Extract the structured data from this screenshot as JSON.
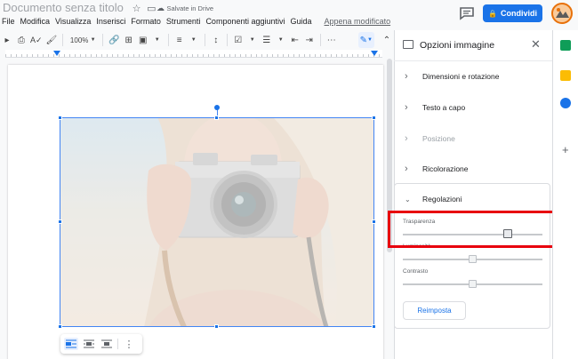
{
  "document": {
    "title": "Documento senza titolo",
    "saved_status": "Salvate in Drive"
  },
  "menu": {
    "items": [
      "File",
      "Modifica",
      "Visualizza",
      "Inserisci",
      "Formato",
      "Strumenti",
      "Componenti aggiuntivi",
      "Guida"
    ],
    "last_edit": "Appena modificato"
  },
  "header": {
    "share_label": "Condividi"
  },
  "toolbar": {
    "zoom": "100%"
  },
  "panel": {
    "title": "Opzioni immagine",
    "sections": [
      {
        "label": "Dimensioni e rotazione",
        "enabled": true
      },
      {
        "label": "Testo a capo",
        "enabled": true
      },
      {
        "label": "Posizione",
        "enabled": false
      },
      {
        "label": "Ricolorazione",
        "enabled": true
      },
      {
        "label": "Regolazioni",
        "enabled": true,
        "expanded": true
      }
    ],
    "adjustments": {
      "transparency_label": "Trasparenza",
      "transparency_value": 0.75,
      "brightness_label": "Luminosità",
      "brightness_value": 0.5,
      "contrast_label": "Contrasto",
      "contrast_value": 0.5
    },
    "reset_label": "Reimposta"
  },
  "colors": {
    "accent": "#1a73e8",
    "highlight": "#e8000d"
  }
}
